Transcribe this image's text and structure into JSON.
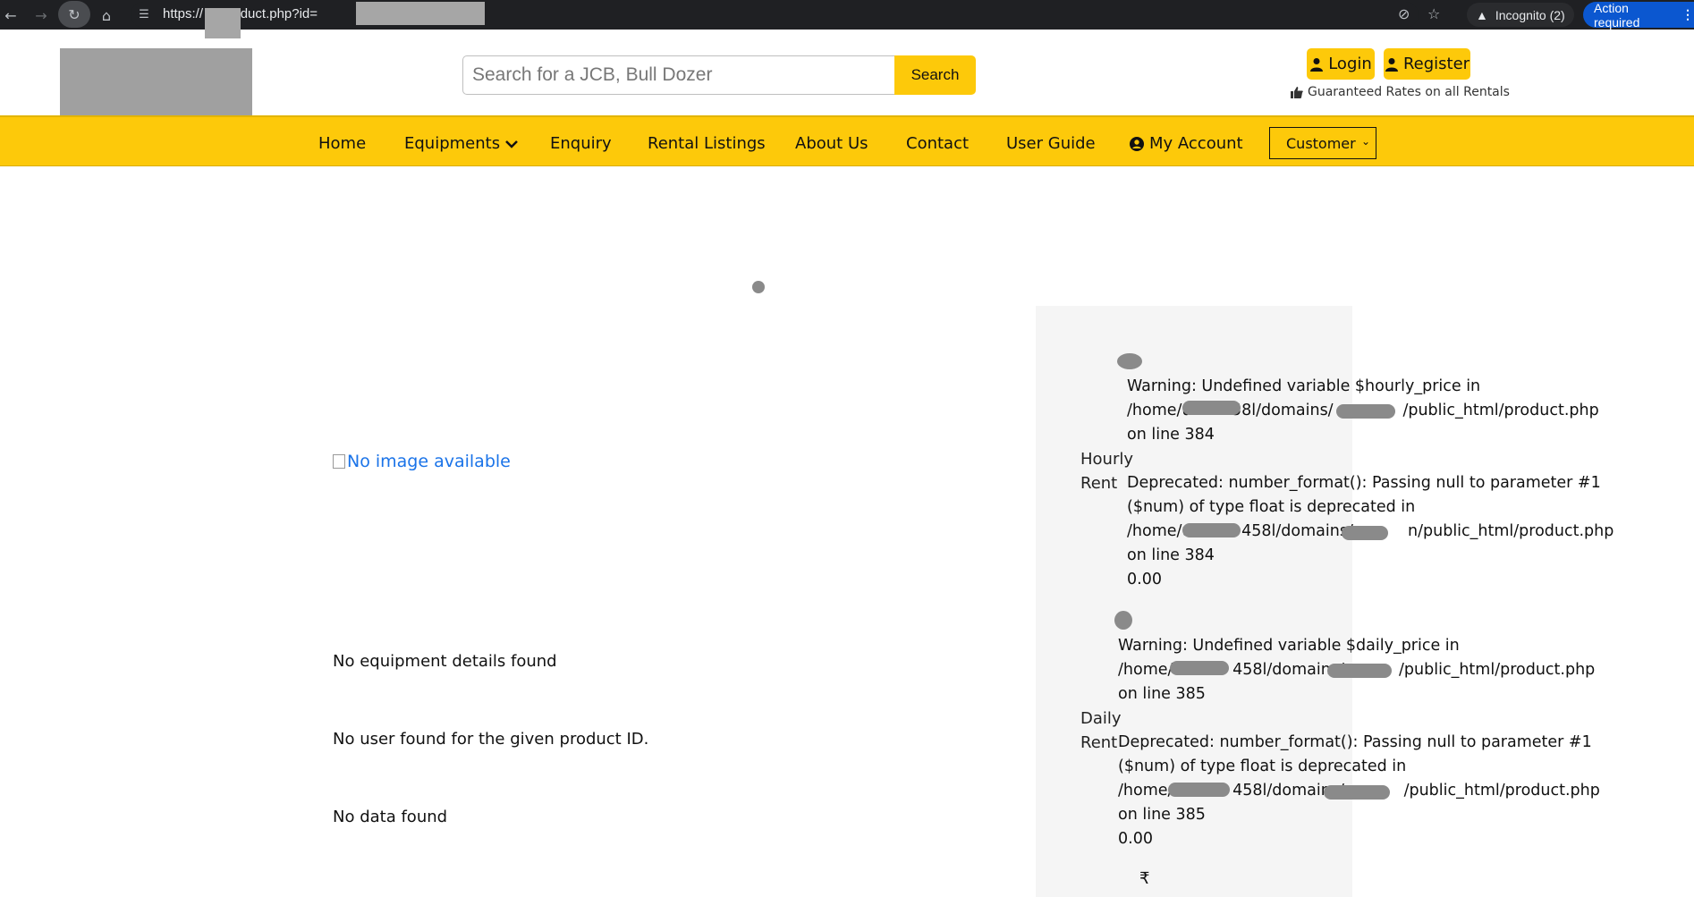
{
  "browser": {
    "url": "https://        in/product.php?id=",
    "incognito_label": "Incognito (2)",
    "action_required_label": "Action required"
  },
  "header": {
    "search_placeholder": "Search for a JCB, Bull Dozer",
    "search_button": "Search",
    "login_button": "Login",
    "register_button": "Register",
    "guarantee_text": "Guaranteed Rates on all Rentals"
  },
  "nav": {
    "items": [
      {
        "label": "Home"
      },
      {
        "label": "Equipments"
      },
      {
        "label": "Enquiry"
      },
      {
        "label": "Rental Listings"
      },
      {
        "label": "About Us"
      },
      {
        "label": "Contact"
      },
      {
        "label": "User Guide"
      },
      {
        "label": "My Account"
      }
    ],
    "role_select": "Customer"
  },
  "product": {
    "image_alt": "No image available",
    "no_details": "No equipment details found",
    "no_user": "No user found for the given product ID.",
    "no_data": "No data found"
  },
  "pricing": {
    "hourly": {
      "label_line1": "Hourly",
      "label_line2": "Rent",
      "warning": [
        "Warning: Undefined variable $hourly_price in",
        "/home/u        58l/domains/              /public_html/product.php",
        "on line 384"
      ],
      "deprecated": [
        "Deprecated: number_format(): Passing null to parameter #1",
        "($num) of type float is deprecated in",
        "/home/u          458l/domains/           n/public_html/product.php",
        "on line 384"
      ],
      "value": "0.00"
    },
    "daily": {
      "label_line1": "Daily",
      "label_line2": "Rent",
      "warning": [
        "Warning: Undefined variable $daily_price in",
        "/home/u          458l/domains/           /public_html/product.php",
        "on line 385"
      ],
      "deprecated": [
        "Deprecated: number_format(): Passing null to parameter #1",
        "($num) of type float is deprecated in",
        "/home/u          458l/domains/            /public_html/product.php",
        "on line 385"
      ],
      "value": "0.00"
    },
    "currency_symbol": "₹"
  }
}
